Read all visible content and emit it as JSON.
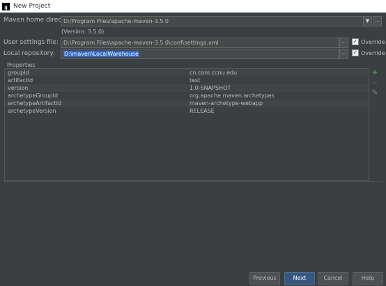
{
  "window": {
    "icon_label": "IJ",
    "title": "New Project"
  },
  "maven_home": {
    "label": "Maven home directory:",
    "value": "D:/Program Files/apache-maven-3.5.0",
    "arrow": "▼",
    "browse": "..."
  },
  "version_text": "(Version: 3.5.0)",
  "user_settings": {
    "label": "User settings file:",
    "value": "D:\\Program Files\\apache-maven-3.5.0\\conf\\settings.xml",
    "browse": "...",
    "override_label": "Override",
    "override_checked": "✓"
  },
  "local_repo": {
    "label": "Local repository:",
    "value": "D:\\maven\\LocalWarehouse",
    "browse": "...",
    "override_label": "Override",
    "override_checked": "✓"
  },
  "properties": {
    "title": "Properties",
    "rows": [
      {
        "key": "groupId",
        "value": "cn.com.ccnu.edu"
      },
      {
        "key": "artifactId",
        "value": "test"
      },
      {
        "key": "version",
        "value": "1.0-SNAPSHOT"
      },
      {
        "key": "archetypeGroupId",
        "value": "org.apache.maven.archetypes"
      },
      {
        "key": "archetypeArtifactId",
        "value": "maven-archetype-webapp"
      },
      {
        "key": "archetypeVersion",
        "value": "RELEASE"
      }
    ],
    "add_icon": "+",
    "remove_icon": "−",
    "edit_icon": "✎",
    "add_color": "#59a869"
  },
  "buttons": {
    "previous": "Previous",
    "next": "Next",
    "cancel": "Cancel",
    "help": "Help"
  },
  "colors": {
    "background": "#3c3f41",
    "selection": "#2f65ca",
    "primary_button": "#365880"
  }
}
